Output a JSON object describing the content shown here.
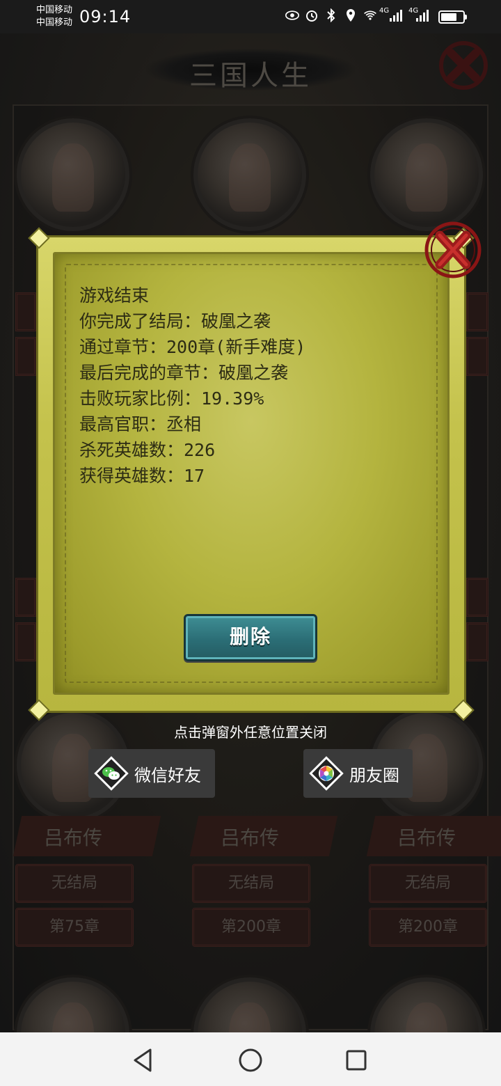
{
  "status_bar": {
    "carrier_1": "中国移动",
    "carrier_2": "中国移动",
    "time": "09:14",
    "icons": [
      "eye-icon",
      "alarm-icon",
      "bluetooth-icon",
      "location-icon",
      "wifi-icon",
      "signal-icon",
      "signal-icon",
      "battery-icon"
    ],
    "network_1": "4G",
    "network_2": "4G"
  },
  "game": {
    "title": "三国人生",
    "cards_row_bottom": [
      {
        "name": "吕布传",
        "ending": "无结局",
        "chapter": "第75章"
      },
      {
        "name": "吕布传",
        "ending": "无结局",
        "chapter": "第200章"
      },
      {
        "name": "吕布传",
        "ending": "无结局",
        "chapter": "第200章"
      }
    ]
  },
  "modal": {
    "lines": [
      "游戏结束",
      "你完成了结局：破凰之袭",
      "通过章节：200章(新手难度)",
      "最后完成的章节：破凰之袭",
      "击败玩家比例：19.39%",
      "最高官职：丞相",
      "杀死英雄数：226",
      "获得英雄数：17"
    ],
    "delete_label": "删除",
    "close_hint": "点击弹窗外任意位置关闭"
  },
  "share": {
    "wechat_label": "微信好友",
    "moments_label": "朋友圈"
  },
  "colors": {
    "modal_paper": "#b4b43f",
    "delete_button": "#2b6e76",
    "close_red": "#9a1b1b"
  }
}
